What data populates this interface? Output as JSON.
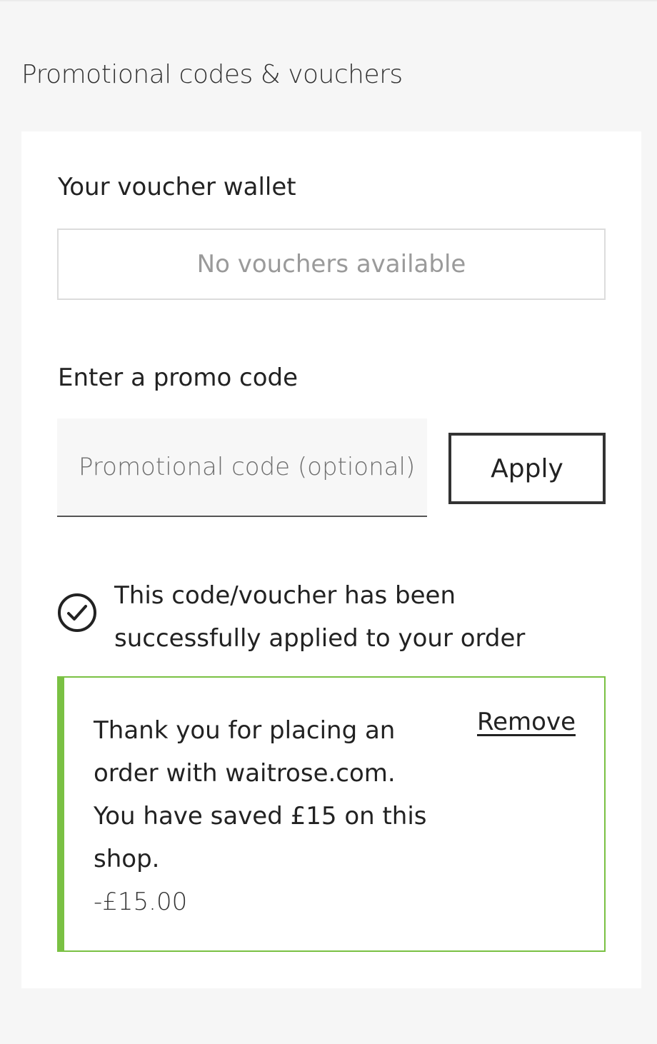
{
  "section": {
    "title": "Promotional codes & vouchers"
  },
  "wallet": {
    "title": "Your voucher wallet",
    "empty_message": "No vouchers available"
  },
  "promo": {
    "title": "Enter a promo code",
    "placeholder": "Promotional code (optional)",
    "value": "",
    "apply_label": "Apply"
  },
  "status": {
    "icon": "check-circle-icon",
    "message": "This code/voucher has been successfully applied to your order"
  },
  "applied_voucher": {
    "message": "Thank you for placing an order with waitrose.com. You have saved £15 on this shop.",
    "amount": "-£15.00",
    "remove_label": "Remove",
    "accent_color": "#7ac143"
  }
}
